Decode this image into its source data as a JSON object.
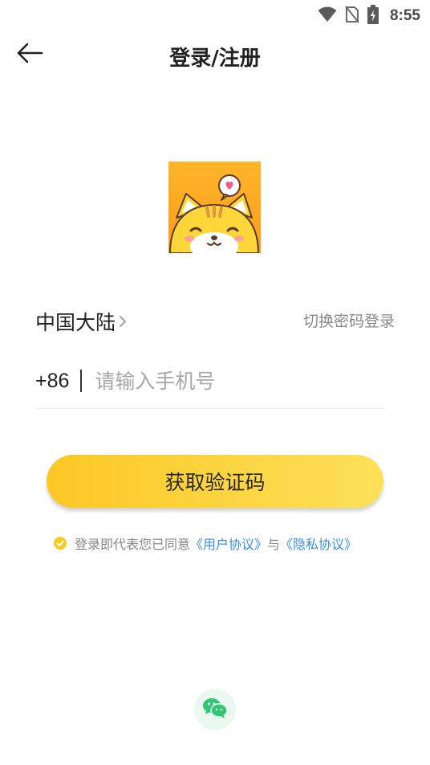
{
  "status_bar": {
    "time": "8:55",
    "icons": [
      "wifi-icon",
      "no-sim-icon",
      "battery-charging-icon"
    ]
  },
  "header": {
    "back_icon": "arrow-left-icon",
    "title": "登录/注册"
  },
  "logo": {
    "icon": "cat-mascot-logo"
  },
  "region": {
    "label": "中国大陆",
    "chevron_icon": "chevron-right-icon",
    "switch_link": "切换密码登录"
  },
  "phone": {
    "country_code": "+86",
    "placeholder": "请输入手机号",
    "value": ""
  },
  "submit": {
    "label": "获取验证码"
  },
  "agreement": {
    "checked": true,
    "prefix": "登录即代表您已同意",
    "user_agreement": "《用户协议》",
    "conjunction": "与",
    "privacy_policy": "《隐私协议》"
  },
  "social_login": {
    "wechat_icon": "wechat-icon"
  },
  "colors": {
    "accent_yellow": "#fcc824",
    "link_blue": "#3a8ee6",
    "wechat_green": "#2ec773"
  }
}
